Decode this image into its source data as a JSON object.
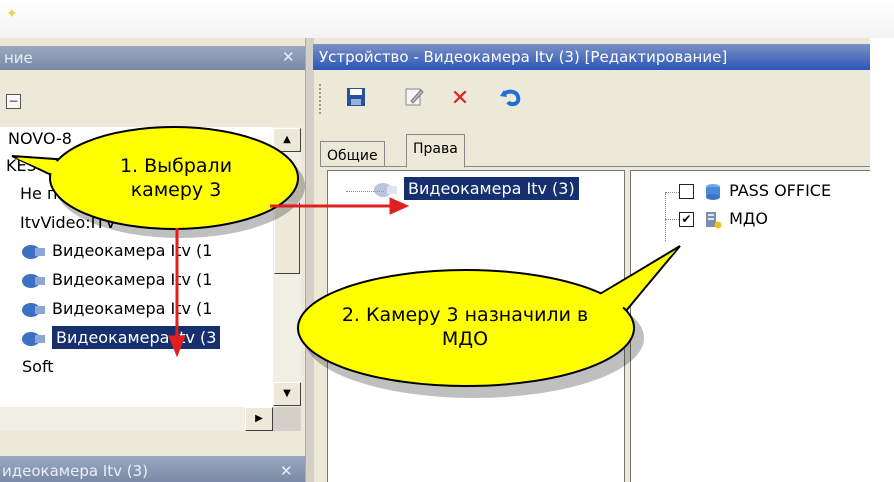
{
  "left_panel": {
    "title": "ние",
    "tree_rows": [
      {
        "label": "NOVO-8",
        "selected": false
      },
      {
        "label": "KE3",
        "selected": false
      },
      {
        "label": "Не под",
        "selected": false
      },
      {
        "label": "ItvVideo:ITV",
        "selected": false
      },
      {
        "label": "Видеокамера Itv (1",
        "selected": false
      },
      {
        "label": "Видеокамера Itv (1",
        "selected": false
      },
      {
        "label": "Видеокамера Itv (1",
        "selected": false
      },
      {
        "label": "Видеокамера Itv (3",
        "selected": true
      },
      {
        "label": "Soft",
        "selected": false
      }
    ],
    "bottom_title": "идеокамера Itv (3)"
  },
  "right_panel": {
    "title": "Устройство - Видеокамера Itv (3) [Редактирование]",
    "tabs": [
      "Общие",
      "Права"
    ],
    "active_tab": "Права",
    "device_item": "Видеокамера Itv (3)",
    "rights": [
      {
        "label": "PASS OFFICE",
        "checked": false
      },
      {
        "label": "МДО",
        "checked": true
      }
    ]
  },
  "callouts": {
    "first": "1. Выбрали камеру 3",
    "second": "2. Камеру 3 назначили в МДО"
  },
  "colors": {
    "selection": "#16306f",
    "callout_fill": "#ffff00",
    "arrow": "#e02020"
  }
}
